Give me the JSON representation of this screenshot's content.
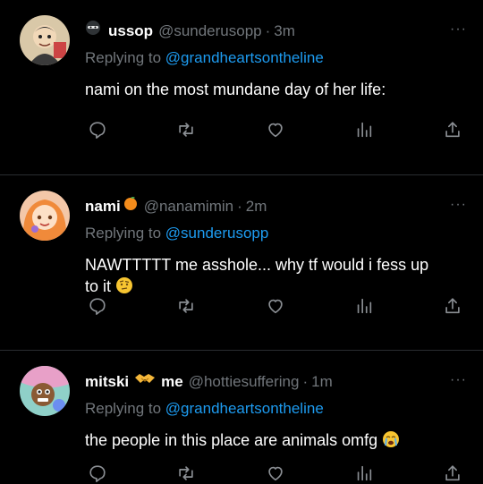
{
  "tweets": [
    {
      "name": "ussop",
      "name_prefix_icon": "ninja-emoji",
      "handle": "@sunderusopp",
      "time": "3m",
      "reply_prefix": "Replying to ",
      "reply_to": "@grandheartsontheline",
      "text": "nami on the most mundane day of her life:",
      "more": "···"
    },
    {
      "name": "nami",
      "name_suffix_icon": "tangerine-emoji",
      "handle": "@nanamimin",
      "time": "2m",
      "reply_prefix": "Replying to ",
      "reply_to": "@sunderusopp",
      "text_line1": "NAWTTTTT me asshole... why tf would i fess up",
      "text_line2": "to it",
      "text_emoji": "raised-eyebrow-emoji",
      "more": "···"
    },
    {
      "name_left": "mitski",
      "name_mid_icon": "handshake-emoji",
      "name_right": "me",
      "handle": "@hottiesuffering",
      "time": "1m",
      "reply_prefix": "Replying to ",
      "reply_to": "@grandheartsontheline",
      "text": "the people in this place are animals omfg",
      "text_emoji": "loudly-crying-emoji",
      "more": "···"
    }
  ],
  "actions": [
    "reply-icon",
    "retweet-icon",
    "like-icon",
    "analytics-icon",
    "share-icon"
  ],
  "colors": {
    "background": "#000000",
    "mention": "#1d9bf0",
    "muted": "#71767b"
  }
}
